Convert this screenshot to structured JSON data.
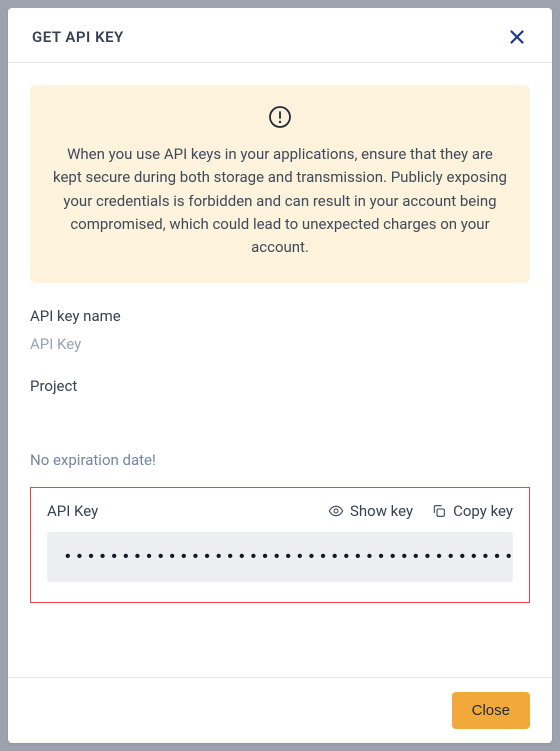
{
  "modal": {
    "title": "GET API KEY",
    "warning": "When you use API keys in your applications, ensure that they are kept secure during both storage and transmission. Publicly exposing your credentials is forbidden and can result in your account being compromised, which could lead to unexpected charges on your account.",
    "fields": {
      "key_name_label": "API key name",
      "key_name_value": "API Key",
      "project_label": "Project",
      "project_value": "",
      "expiration_text": "No expiration date!",
      "api_key_label": "API Key",
      "show_key_label": "Show key",
      "copy_key_label": "Copy key",
      "masked_key": "•••••••••••••••••••••••••••••••••••••••••••"
    },
    "footer": {
      "close_label": "Close"
    }
  }
}
